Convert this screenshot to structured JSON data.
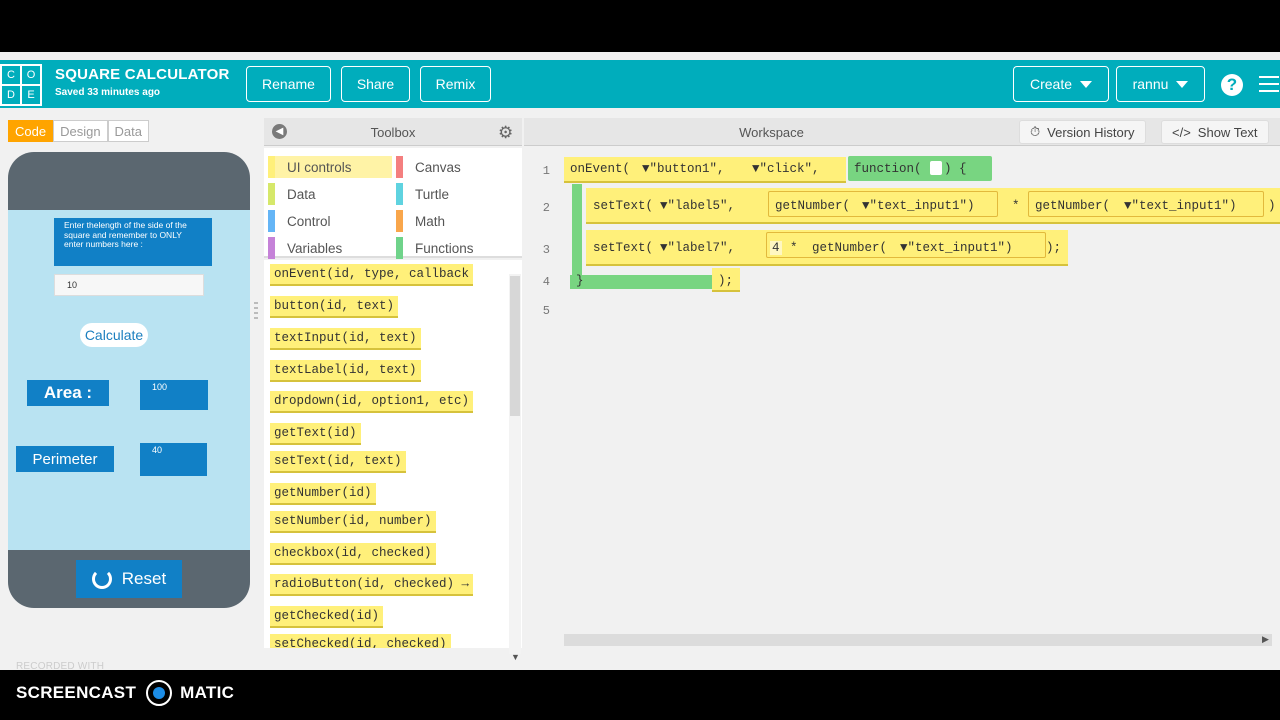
{
  "header": {
    "logo_letters": [
      "C",
      "O",
      "D",
      "E"
    ],
    "title": "SQUARE CALCULATOR",
    "saved": "Saved 33 minutes ago",
    "rename": "Rename",
    "share": "Share",
    "remix": "Remix",
    "create": "Create",
    "user": "rannu",
    "help": "?"
  },
  "modes": {
    "code": "Code",
    "design": "Design",
    "data": "Data"
  },
  "app": {
    "instructions": "Enter thelength of the side of  the square and remember to ONLY enter numbers here :",
    "input_value": "10",
    "calculate": "Calculate",
    "area_label": "Area :",
    "area_value": "100",
    "perimeter_label": "Perimeter",
    "perimeter_value": "40",
    "reset": "Reset"
  },
  "toolbox": {
    "title": "Toolbox",
    "categories": [
      {
        "label": "UI controls",
        "color": "#fff07a"
      },
      {
        "label": "Canvas",
        "color": "#f47f7f"
      },
      {
        "label": "Data",
        "color": "#d6e86a"
      },
      {
        "label": "Turtle",
        "color": "#5fd3e0"
      },
      {
        "label": "Control",
        "color": "#64b5f6"
      },
      {
        "label": "Math",
        "color": "#f9a64b"
      },
      {
        "label": "Variables",
        "color": "#c582d8"
      },
      {
        "label": "Functions",
        "color": "#6fd38a"
      }
    ],
    "blocks": [
      "onEvent(id, type, callback",
      "button(id, text)",
      "textInput(id, text)",
      "textLabel(id, text)",
      "dropdown(id, option1, etc)",
      "getText(id)",
      "setText(id, text)",
      "getNumber(id)",
      "setNumber(id, number)",
      "checkbox(id, checked)",
      "radioButton(id, checked) →",
      "getChecked(id)",
      "setChecked(id, checked)"
    ]
  },
  "workspace": {
    "title": "Workspace",
    "version_history": "Version History",
    "show_text": "Show Text",
    "line_numbers": [
      "1",
      "2",
      "3",
      "4",
      "5"
    ],
    "line1": {
      "fn": "onEvent(",
      "arg1": "▼\"button1\",",
      "arg2": "▼\"click\",",
      "func": "function(",
      "func_end": ") {"
    },
    "line2": {
      "fn": "setText(",
      "arg1": "▼\"label5\",",
      "inner1": "getNumber(",
      "inner1_arg": "▼\"text_input1\")",
      "op": "*",
      "inner2": "getNumber(",
      "inner2_arg": "▼\"text_input1\")",
      "end": ")"
    },
    "line3": {
      "fn": "setText(",
      "arg1": "▼\"label7\",",
      "num": "4",
      "op": "*",
      "inner": "getNumber(",
      "inner_arg": "▼\"text_input1\")",
      "end": ");"
    },
    "line4": {
      "close": "}",
      "end": ");"
    }
  },
  "watermark": {
    "small": "RECORDED WITH",
    "left": "SCREENCAST",
    "right": "MATIC"
  }
}
